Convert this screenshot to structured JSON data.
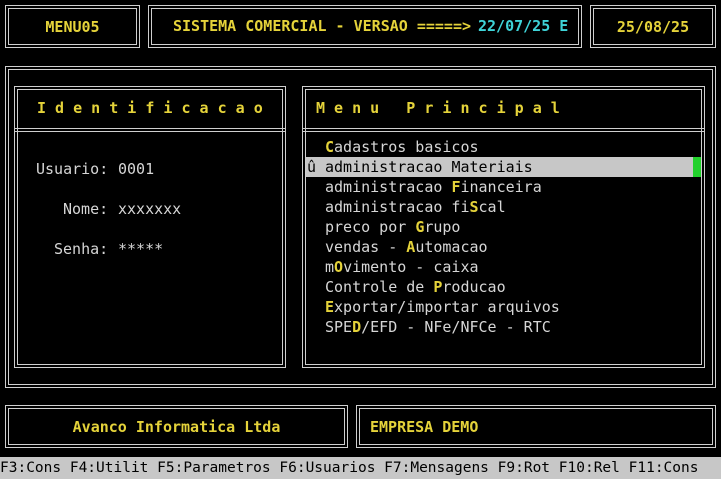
{
  "header": {
    "menu_id": "MENU05",
    "system_title": "SISTEMA COMERCIAL - VERSAO =====>",
    "version_date": "22/07/25 E",
    "current_date": "25/08/25"
  },
  "identification": {
    "title": "I d e n t i f i c a c a o",
    "user_label": "Usuario:",
    "user_value": "0001",
    "name_label": "Nome:",
    "name_value": "xxxxxxx",
    "password_label": "Senha:",
    "password_value": "*****"
  },
  "menu": {
    "title": "M e n u   P r i n c i p a l",
    "selection_marker": "û",
    "items": [
      {
        "pre": "",
        "hot": "C",
        "post": "adastros basicos"
      },
      {
        "pre": "administracao ",
        "hot": "M",
        "post": "ateriais"
      },
      {
        "pre": "administracao ",
        "hot": "F",
        "post": "inanceira"
      },
      {
        "pre": "administracao fi",
        "hot": "S",
        "post": "cal"
      },
      {
        "pre": "preco por ",
        "hot": "G",
        "post": "rupo"
      },
      {
        "pre": "vendas - ",
        "hot": "A",
        "post": "utomacao"
      },
      {
        "pre": "m",
        "hot": "O",
        "post": "vimento - caixa"
      },
      {
        "pre": "Controle de ",
        "hot": "P",
        "post": "roducao"
      },
      {
        "pre": "",
        "hot": "E",
        "post": "xportar/importar arquivos"
      },
      {
        "pre": "SPE",
        "hot": "D",
        "post": "/EFD - NFe/NFCe - RTC"
      }
    ]
  },
  "footer": {
    "company": "Avanco Informatica Ltda",
    "client": "EMPRESA DEMO"
  },
  "function_keys": [
    "F3:Cons",
    "F4:Utilit",
    "F5:Parametros",
    "F6:Usuarios",
    "F7:Mensagens",
    "F9:Rot",
    "F10:Rel",
    "F11:Cons"
  ]
}
